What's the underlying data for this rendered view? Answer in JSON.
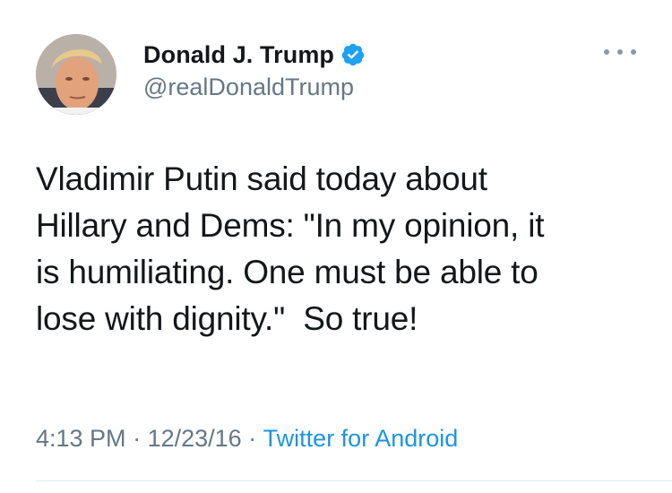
{
  "tweet": {
    "display_name": "Donald J. Trump",
    "handle": "@realDonaldTrump",
    "text": "Vladimir Putin said today about\nHillary and Dems: \"In my opinion, it\nis humiliating. One must be able to\nlose with dignity.\"  So true!",
    "time": "4:13 PM",
    "separator": " · ",
    "date": "12/23/16",
    "source": "Twitter for Android"
  },
  "icons": {
    "verified": "verified-badge-icon",
    "more": "more-options-icon"
  },
  "colors": {
    "text": "#14171a",
    "secondary": "#657786",
    "link": "#1b95e0",
    "verified": "#1da1f2",
    "divider": "#e1e8ed"
  }
}
